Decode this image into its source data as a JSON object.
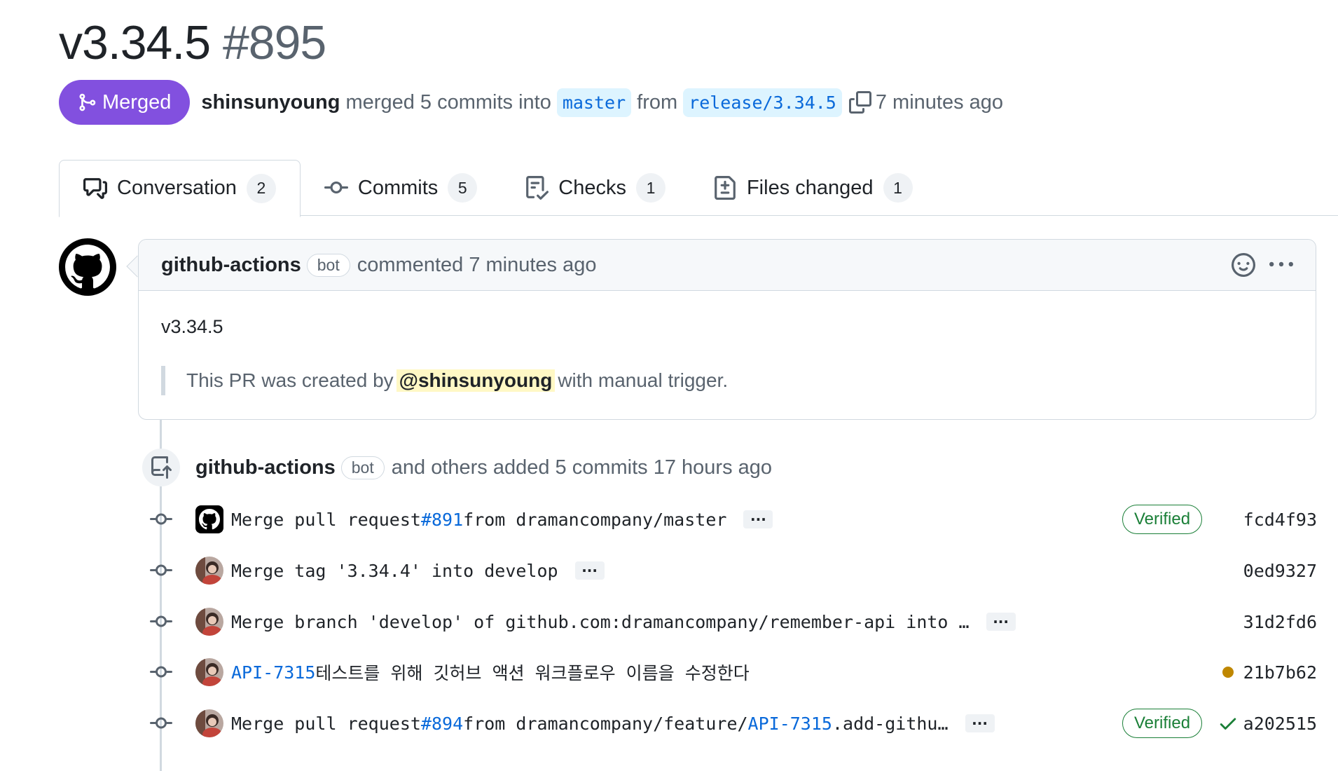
{
  "pr": {
    "title": "v3.34.5",
    "number": "#895",
    "status": "Merged",
    "author": "shinsunyoung",
    "action_text": "merged 5 commits into",
    "base_branch": "master",
    "from_text": "from",
    "head_branch": "release/3.34.5",
    "time": "7 minutes ago"
  },
  "tabs": [
    {
      "label": "Conversation",
      "count": "2",
      "icon": "comment-discussion-icon",
      "active": true
    },
    {
      "label": "Commits",
      "count": "5",
      "icon": "git-commit-icon",
      "active": false
    },
    {
      "label": "Checks",
      "count": "1",
      "icon": "checklist-icon",
      "active": false
    },
    {
      "label": "Files changed",
      "count": "1",
      "icon": "file-diff-icon",
      "active": false
    }
  ],
  "comment": {
    "author": "github-actions",
    "bot_label": "bot",
    "meta": "commented 7 minutes ago",
    "version": "v3.34.5",
    "quote_prefix": "This PR was created by",
    "mention": "@shinsunyoung",
    "quote_suffix": "with manual trigger."
  },
  "commits_header": {
    "author": "github-actions",
    "bot_label": "bot",
    "text": "and others added 5 commits 17 hours ago"
  },
  "commits": [
    {
      "pre": "Merge pull request ",
      "link": "#891",
      "post": " from dramancompany/master",
      "sha": "fcd4f93",
      "verified": "Verified",
      "avatar": "github-avatar"
    },
    {
      "pre": "Merge tag '3.34.4' into develop",
      "link": "",
      "post": "",
      "sha": "0ed9327",
      "verified": "",
      "avatar": "user-avatar"
    },
    {
      "pre": "Merge branch 'develop' of github.com:dramancompany/remember-api into …",
      "link": "",
      "post": "",
      "sha": "31d2fd6",
      "verified": "",
      "avatar": "user-avatar"
    },
    {
      "pre": "",
      "link": "API-7315",
      "post": " 테스트를 위해 깃허브 액션 워크플로우 이름을 수정한다",
      "sha": "21b7b62",
      "verified": "",
      "avatar": "user-avatar",
      "status": "pending"
    },
    {
      "pre": "Merge pull request ",
      "link": "#894",
      "post": " from dramancompany/feature/",
      "link2": "API-7315",
      "post2": ".add-githu…",
      "sha": "a202515",
      "verified": "Verified",
      "avatar": "user-avatar",
      "status": "success"
    }
  ],
  "ellipsis": "···",
  "colors": {
    "merged": "#8250df",
    "link": "#0969da",
    "verified": "#1a7f37",
    "pending": "#bf8700",
    "mention_bg": "#fff8c5"
  }
}
